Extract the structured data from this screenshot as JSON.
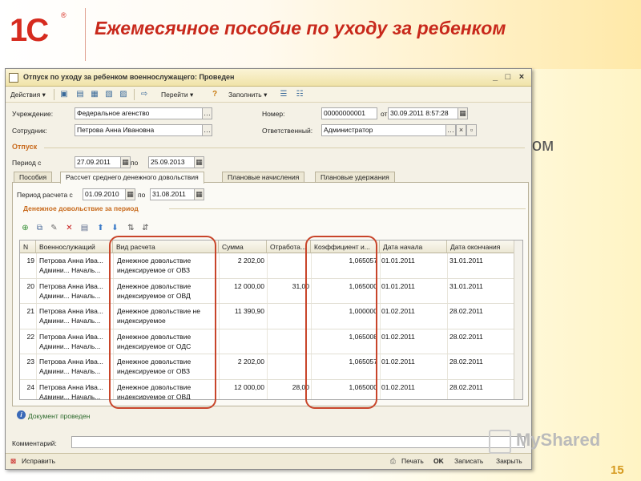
{
  "slide": {
    "logo": "1С",
    "title": "Ежемесячное пособие по уходу за ребенком",
    "background_word": "ком",
    "page_number": "15",
    "watermark": "MyShared"
  },
  "window": {
    "title": "Отпуск по уходу за ребенком военнослужащего: Проведен",
    "controls": [
      "_",
      "□",
      "×"
    ]
  },
  "toolbar": {
    "actions": "Действия",
    "goto": "Перейти",
    "help": "?",
    "fill": "Заполнить"
  },
  "form": {
    "org_label": "Учреждение:",
    "org_value": "Федеральное агенство",
    "employee_label": "Сотрудник:",
    "employee_value": "Петрова Анна Ивановна",
    "number_label": "Номер:",
    "number_value": "00000000001",
    "from_label": "от",
    "date_value": "30.09.2011  8:57:28",
    "responsible_label": "Ответственный:",
    "responsible_value": "Администратор",
    "vacation_group": "Отпуск",
    "period_from_label": "Период с",
    "period_from": "27.09.2011",
    "period_to_label": "по",
    "period_to": "25.09.2013"
  },
  "tabs": [
    {
      "label": "Пособия"
    },
    {
      "label": "Рассчет среднего денежного довольствия"
    },
    {
      "label": "Плановые начисления"
    },
    {
      "label": "Плановые удержания"
    }
  ],
  "calc": {
    "period_label": "Период расчета с",
    "period_from": "01.09.2010",
    "to_label": "по",
    "period_to": "31.08.2011",
    "subgroup": "Денежное довольствие за период"
  },
  "grid": {
    "columns": [
      "N",
      "Военнослужащий",
      "Вид расчета",
      "Сумма",
      "Отработа...",
      "Коэффициент и...",
      "Дата начала",
      "Дата окончания"
    ],
    "rows": [
      {
        "n": "19",
        "emp1": "Петрова Анна Ива...",
        "emp2": "Админи...   Началь...",
        "type1": "Денежное довольствие",
        "type2": "индексируемое от ОВЗ",
        "sum": "2 202,00",
        "worked": "",
        "coef": "1,065057",
        "start": "01.01.2011",
        "end": "31.01.2011"
      },
      {
        "n": "20",
        "emp1": "Петрова Анна Ива...",
        "emp2": "Админи...   Началь...",
        "type1": "Денежное довольствие",
        "type2": "индексируемое от ОВД",
        "sum": "12 000,00",
        "worked": "31,00",
        "coef": "1,065000",
        "start": "01.01.2011",
        "end": "31.01.2011"
      },
      {
        "n": "21",
        "emp1": "Петрова Анна Ива...",
        "emp2": "Админи...   Началь...",
        "type1": "Денежное довольствие не",
        "type2": "индексируемое",
        "sum": "11 390,90",
        "worked": "",
        "coef": "1,000000",
        "start": "01.02.2011",
        "end": "28.02.2011"
      },
      {
        "n": "22",
        "emp1": "Петрова Анна Ива...",
        "emp2": "Админи...   Началь...",
        "type1": "Денежное довольствие",
        "type2": "индексируемое от ОДС",
        "sum": "",
        "worked": "",
        "coef": "1,065008",
        "start": "01.02.2011",
        "end": "28.02.2011"
      },
      {
        "n": "23",
        "emp1": "Петрова Анна Ива...",
        "emp2": "Админи...   Началь...",
        "type1": "Денежное довольствие",
        "type2": "индексируемое от ОВЗ",
        "sum": "2 202,00",
        "worked": "",
        "coef": "1,065057",
        "start": "01.02.2011",
        "end": "28.02.2011"
      },
      {
        "n": "24",
        "emp1": "Петрова Анна Ива...",
        "emp2": "Админи...   Началь...",
        "type1": "Денежное довольствие",
        "type2": "индексируемое от ОВД",
        "sum": "12 000,00",
        "worked": "28,00",
        "coef": "1,065000",
        "start": "01.02.2011",
        "end": "28.02.2011"
      }
    ]
  },
  "status": {
    "text": "Документ проведен"
  },
  "comment": {
    "label": "Комментарий:"
  },
  "bottom": {
    "edit": "Исправить",
    "print": "Печать",
    "ok": "OK",
    "save": "Записать",
    "close": "Закрыть"
  }
}
